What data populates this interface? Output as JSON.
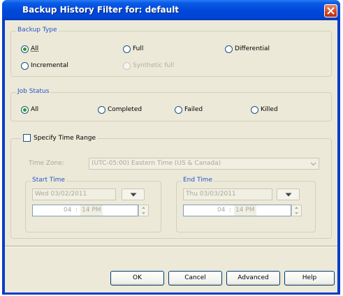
{
  "window": {
    "title": "Backup History Filter for: default"
  },
  "backup_type": {
    "legend": "Backup Type",
    "options": [
      {
        "label": "All",
        "checked": true,
        "enabled": true
      },
      {
        "label": "Full",
        "checked": false,
        "enabled": true
      },
      {
        "label": "Differential",
        "checked": false,
        "enabled": true
      },
      {
        "label": "Incremental",
        "checked": false,
        "enabled": true
      },
      {
        "label": "Synthetic full",
        "checked": false,
        "enabled": false
      }
    ]
  },
  "job_status": {
    "legend": "Job Status",
    "options": [
      {
        "label": "All",
        "checked": true
      },
      {
        "label": "Completed",
        "checked": false
      },
      {
        "label": "Failed",
        "checked": false
      },
      {
        "label": "Killed",
        "checked": false
      }
    ]
  },
  "time_range": {
    "checkbox_label": "Specify Time Range",
    "checked": false,
    "timezone_label": "Time Zone:",
    "timezone_value": "(UTC-05:00) Eastern Time (US & Canada)",
    "start": {
      "legend": "Start Time",
      "date": "Wed 03/02/2011",
      "hour": "04",
      "sep": ":",
      "minute_ampm": "14 PM"
    },
    "end": {
      "legend": "End Time",
      "date": "Thu 03/03/2011",
      "hour": "04",
      "sep": ":",
      "minute_ampm": "14 PM"
    }
  },
  "buttons": {
    "ok": "OK",
    "cancel": "Cancel",
    "advanced": "Advanced",
    "help": "Help"
  },
  "colors": {
    "legend": "#2456c8",
    "title_bar": "#0148d8",
    "radio_dot": "#21a121"
  }
}
